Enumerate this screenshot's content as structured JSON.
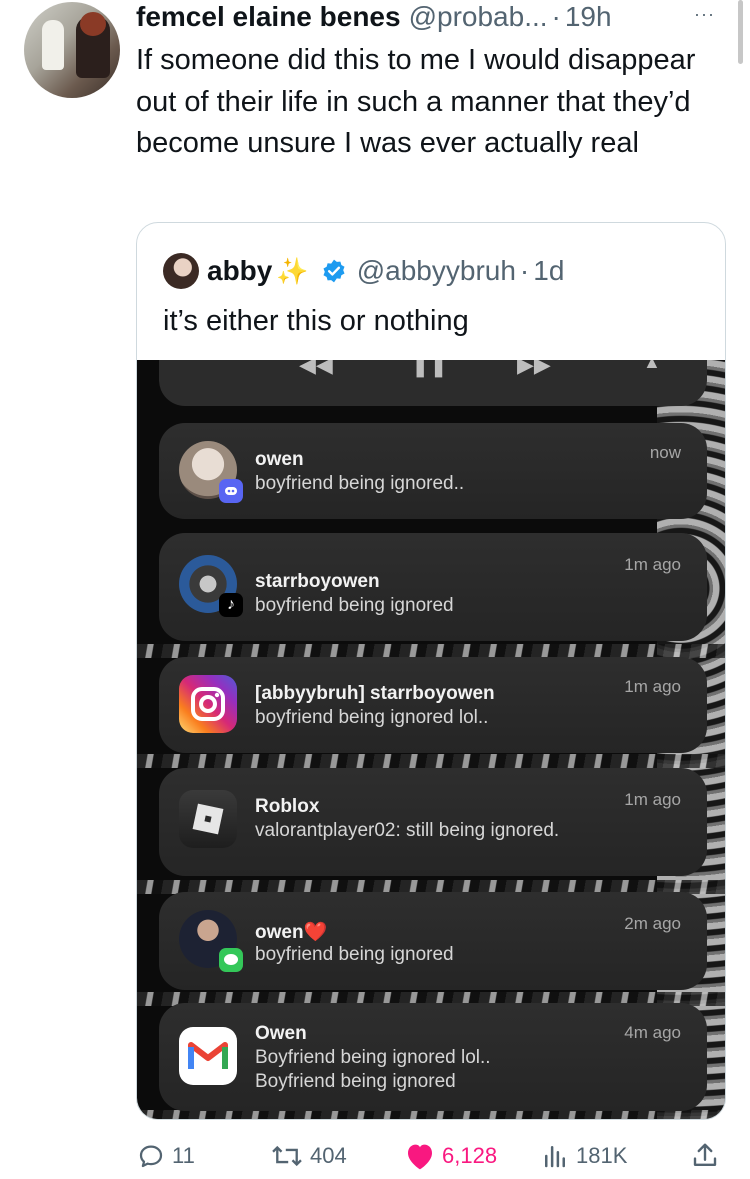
{
  "tweet": {
    "author_name": "femcel elaine benes",
    "author_handle": "@probab...",
    "dot": "·",
    "time": "19h",
    "more_glyph": "···",
    "text": "If someone did this to me I would disappear out of their life in such a manner that they’d become unsure I was ever actually real"
  },
  "quote": {
    "name": "abby",
    "sparkle": "✨",
    "handle": "@abbyybruh",
    "dot": "·",
    "time": "1d",
    "text": "it’s either this or nothing"
  },
  "notifications": [
    {
      "title": "owen",
      "body": "boyfriend being ignored..",
      "time": "now",
      "app_icon": "discord-icon"
    },
    {
      "title": "starrboyowen",
      "body": "boyfriend being ignored",
      "time": "1m ago",
      "app_icon": "tiktok-icon"
    },
    {
      "title": "[abbyybruh] starrboyowen",
      "body": "boyfriend being ignored lol..",
      "time": "1m ago",
      "app_icon": "instagram-icon"
    },
    {
      "title": "Roblox",
      "body": "valorantplayer02: still being ignored.",
      "time": "1m ago",
      "app_icon": "roblox-icon"
    },
    {
      "title": "owen",
      "title_emoji": "❤️",
      "body": "boyfriend being ignored",
      "time": "2m ago",
      "app_icon": "messages-icon"
    },
    {
      "title": "Owen",
      "body": "Boyfriend being ignored lol..",
      "body2": "Boyfriend being ignored",
      "time": "4m ago",
      "app_icon": "gmail-icon"
    }
  ],
  "actions": {
    "replies": "11",
    "reposts": "404",
    "likes": "6,128",
    "views": "181K"
  },
  "colors": {
    "like": "#f91880",
    "verified": "#1d9bf0",
    "secondary_text": "#536471"
  }
}
